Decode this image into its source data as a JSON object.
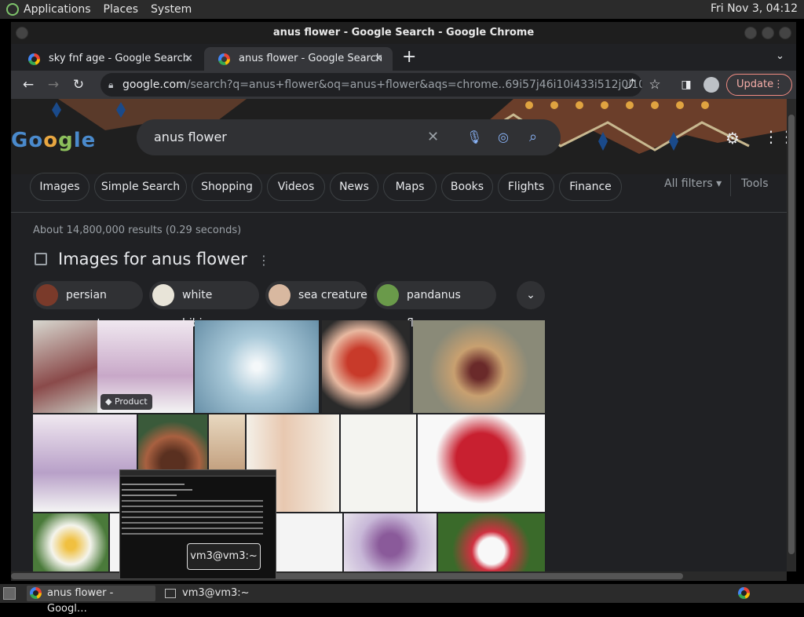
{
  "desktop": {
    "menus": [
      "Applications",
      "Places",
      "System"
    ],
    "clock": "Fri Nov 3, 04:12"
  },
  "window": {
    "title": "anus flower - Google Search - Google Chrome"
  },
  "tabs": [
    {
      "label": "sky fnf age - Google Search",
      "active": false
    },
    {
      "label": "anus flower - Google Search",
      "active": true
    }
  ],
  "toolbar": {
    "url_host": "google.com",
    "url_rest": "/search?q=anus+flower&oq=anus+flower&aqs=chrome..69i57j46i10i433i512j0i10i433i5…",
    "update_label": "Update"
  },
  "search": {
    "query": "anus flower"
  },
  "filters": {
    "chips": [
      "Images",
      "Simple Search",
      "Shopping",
      "Videos",
      "News",
      "Maps",
      "Books",
      "Flights",
      "Finance"
    ],
    "all_filters": "All filters",
    "tools": "Tools"
  },
  "results": {
    "stats": "About 14,800,000 results (0.29 seconds)",
    "images_heading": "Images for anus flower",
    "suggestions": [
      "persian carpet",
      "white hibiscus",
      "sea creature",
      "pandanus flower"
    ],
    "product_badge": "Product"
  },
  "taskbar": {
    "tasks": [
      "anus flower - Googl…",
      "vm3@vm3:~"
    ],
    "term_tooltip": "vm3@vm3:~"
  },
  "colors": {
    "accent_blue": "#8ab4f8",
    "update_border": "#f28b82"
  }
}
